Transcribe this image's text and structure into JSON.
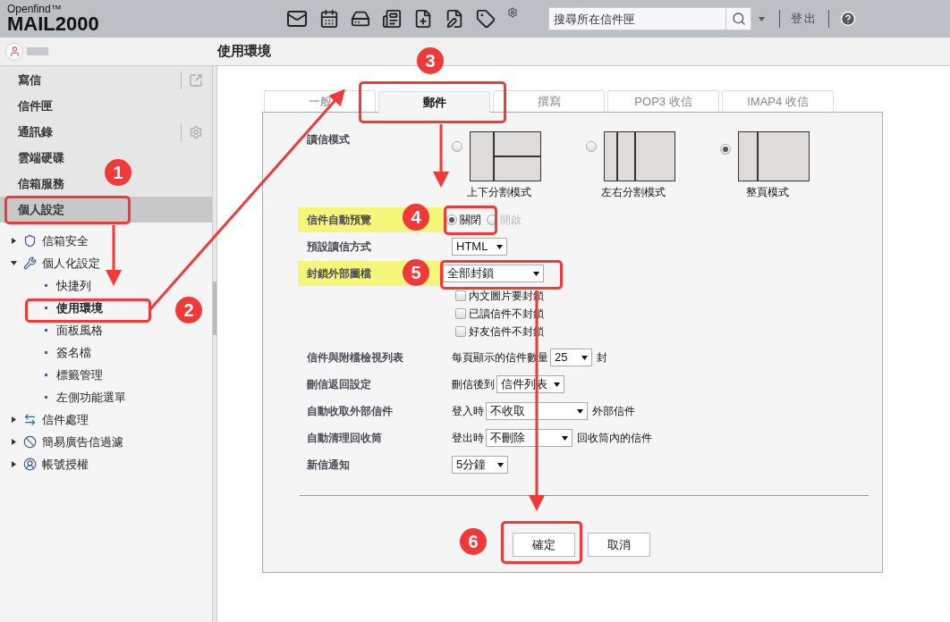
{
  "header": {
    "logo_top": "Openfind™",
    "logo_main": "MAIL2000",
    "search": {
      "placeholder": "搜尋所在信件匣"
    },
    "logout": "登出"
  },
  "page_title": "使用環境",
  "sidebar": {
    "items": [
      {
        "label": "寫信",
        "selected": false,
        "kind": "external"
      },
      {
        "label": "信件匣",
        "selected": false,
        "kind": "plain"
      },
      {
        "label": "通訊錄",
        "selected": false,
        "kind": "settings"
      },
      {
        "label": "雲端硬碟",
        "selected": false,
        "kind": "plain"
      },
      {
        "label": "信箱服務",
        "selected": false,
        "kind": "plain"
      },
      {
        "label": "個人設定",
        "selected": true,
        "kind": "plain"
      }
    ],
    "tree": [
      {
        "label": "信箱安全",
        "kind": "shield",
        "expanded": false
      },
      {
        "label": "個人化設定",
        "kind": "tools",
        "expanded": true,
        "children": [
          {
            "label": "快捷列",
            "selected": false
          },
          {
            "label": "使用環境",
            "selected": true
          },
          {
            "label": "面板風格",
            "selected": false
          },
          {
            "label": "簽名檔",
            "selected": false
          },
          {
            "label": "標籤管理",
            "selected": false
          },
          {
            "label": "左側功能選單",
            "selected": false
          }
        ]
      },
      {
        "label": "信件處理",
        "kind": "arrows",
        "expanded": false
      },
      {
        "label": "簡易廣告信過濾",
        "kind": "ban",
        "expanded": false
      },
      {
        "label": "帳號授權",
        "kind": "user",
        "expanded": false
      }
    ]
  },
  "tabs": [
    {
      "label": "一般",
      "selected": false
    },
    {
      "label": "郵件",
      "selected": true
    },
    {
      "label": "撰寫",
      "selected": false
    },
    {
      "label": "POP3 收信",
      "selected": false
    },
    {
      "label": "IMAP4 收信",
      "selected": false
    }
  ],
  "settings": [
    {
      "kind": "layout",
      "label": "讀信模式",
      "highlighted": false,
      "options": [
        {
          "label": "上下分割模式",
          "kind": "split",
          "selected": false
        },
        {
          "label": "左右分割模式",
          "kind": "columns",
          "selected": false
        },
        {
          "label": "整頁模式",
          "kind": "full",
          "selected": true
        }
      ]
    },
    {
      "kind": "radio",
      "label": "信件自動預覽",
      "highlighted": true,
      "options": [
        {
          "label": "關閉",
          "selected": true,
          "disabled": false
        },
        {
          "label": "開啟",
          "selected": false,
          "disabled": true
        }
      ]
    },
    {
      "kind": "inline",
      "label": "預設讀信方式",
      "highlighted": false,
      "select": "HTML"
    },
    {
      "kind": "inline",
      "label": "封鎖外部圖檔",
      "highlighted": true,
      "select": "全部封鎖",
      "checks": [
        {
          "label": "內文圖片要封鎖",
          "checked": false
        },
        {
          "label": "已讀信件不封鎖",
          "checked": false
        },
        {
          "label": "好友信件不封鎖",
          "checked": false
        }
      ]
    },
    {
      "kind": "inline",
      "label": "信件與附檔檢視列表",
      "highlighted": false,
      "prefix": "每頁顯示的信件數量",
      "select": "25",
      "suffix": "封"
    },
    {
      "kind": "inline",
      "label": "刪信返回設定",
      "highlighted": false,
      "prefix": "刪信後到",
      "select": "信件列表"
    },
    {
      "kind": "inline",
      "label": "自動收取外部信件",
      "highlighted": false,
      "prefix": "登入時",
      "select": "不收取",
      "suffix": "外部信件"
    },
    {
      "kind": "inline",
      "label": "自動清理回收筒",
      "highlighted": false,
      "prefix": "登出時",
      "select": "不刪除",
      "suffix": "回收筒內的信件"
    },
    {
      "kind": "inline",
      "label": "新信通知",
      "highlighted": false,
      "select": "5分鐘"
    }
  ],
  "buttons": [
    {
      "label": "確定"
    },
    {
      "label": "取消"
    }
  ],
  "annotations": [
    {
      "number": "1"
    },
    {
      "number": "2"
    },
    {
      "number": "3"
    },
    {
      "number": "4"
    },
    {
      "number": "5"
    },
    {
      "number": "6"
    }
  ]
}
